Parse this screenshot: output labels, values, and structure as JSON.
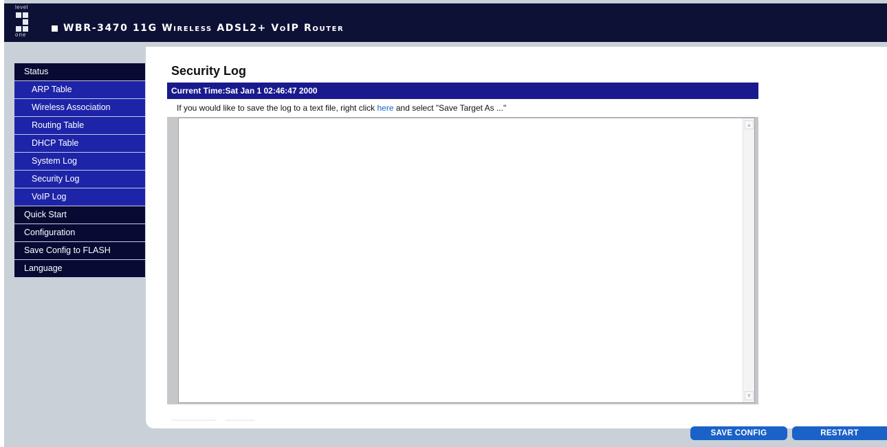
{
  "header": {
    "logo_top": "level",
    "logo_bottom": "one",
    "title": "WBR-3470 11G Wireless ADSL2+ VoIP Router"
  },
  "sidebar": {
    "items": [
      {
        "label": "Status",
        "level": "top"
      },
      {
        "label": "ARP Table",
        "level": "sub"
      },
      {
        "label": "Wireless Association",
        "level": "sub"
      },
      {
        "label": "Routing Table",
        "level": "sub"
      },
      {
        "label": "DHCP Table",
        "level": "sub"
      },
      {
        "label": "System Log",
        "level": "sub"
      },
      {
        "label": "Security Log",
        "level": "sub"
      },
      {
        "label": "VoIP Log",
        "level": "sub"
      },
      {
        "label": "Quick Start",
        "level": "top"
      },
      {
        "label": "Configuration",
        "level": "top"
      },
      {
        "label": "Save Config to FLASH",
        "level": "top"
      },
      {
        "label": "Language",
        "level": "top"
      }
    ]
  },
  "main": {
    "title": "Security Log",
    "current_time": "Current Time:Sat Jan 1 02:46:47 2000",
    "save_note_before": "If you would like to save the log to a text file, right click ",
    "save_note_link": "here",
    "save_note_after": " and select \"Save Target As ...\"",
    "log_content": ""
  },
  "footer": {
    "save_config_label": "SAVE CONFIG",
    "restart_label": "RESTART"
  },
  "colors": {
    "header_bg": "#0e1136",
    "nav_top_bg": "#080a34",
    "nav_sub_bg": "#1d24a8",
    "time_bar_bg": "#1a1a8e",
    "button_bg": "#1a62c8",
    "link": "#1a5fd0"
  },
  "icons": {
    "scroll_up": "chevron-up-icon",
    "scroll_down": "chevron-down-icon"
  }
}
